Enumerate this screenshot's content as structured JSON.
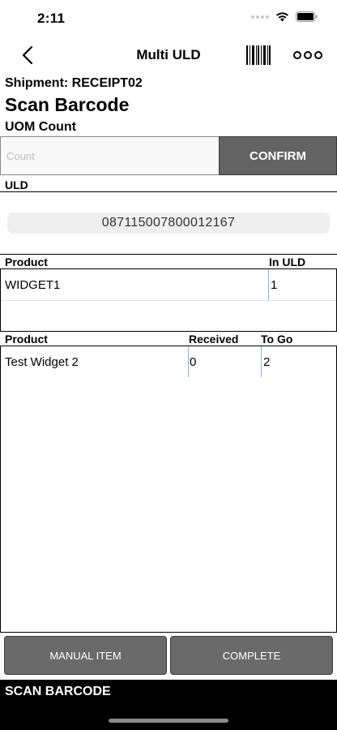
{
  "status_bar": {
    "time": "2:11"
  },
  "nav": {
    "title": "Multi ULD"
  },
  "header": {
    "shipment": "Shipment: RECEIPT02",
    "title": "Scan Barcode",
    "uom_label": "UOM Count"
  },
  "count_input": {
    "placeholder": "Count",
    "value": ""
  },
  "confirm_label": "CONFIRM",
  "uld": {
    "label": "ULD",
    "value": "087115007800012167"
  },
  "uld_table": {
    "headers": [
      "Product",
      "In ULD"
    ],
    "rows": [
      {
        "product": "WIDGET1",
        "in_uld": "1"
      }
    ]
  },
  "receive_table": {
    "headers": [
      "Product",
      "Received",
      "To Go"
    ],
    "rows": [
      {
        "product": "Test Widget 2",
        "received": "0",
        "to_go": "2"
      }
    ]
  },
  "buttons": {
    "manual_item": "MANUAL ITEM",
    "complete": "COMPLETE"
  },
  "footer": {
    "message": "SCAN BARCODE"
  },
  "colors": {
    "button_gray": "#636363",
    "divider_blue": "#8ab6d6",
    "footer_bg": "#000000"
  },
  "icons": {
    "back": "chevron-left-icon",
    "barcode": "barcode-icon",
    "more": "more-icon",
    "wifi": "wifi-icon",
    "battery": "battery-icon"
  }
}
